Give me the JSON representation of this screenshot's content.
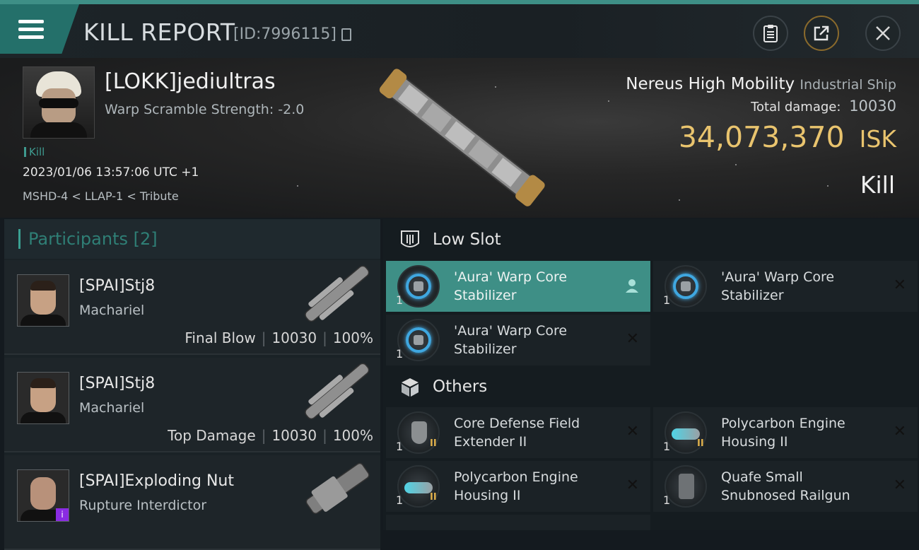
{
  "header": {
    "title": "KILL REPORT",
    "report_id": "[ID:7996115]",
    "clipboard_icon": "clipboard-icon",
    "share_icon": "share-icon",
    "close_icon": "close-icon"
  },
  "victim": {
    "name": "[LOKK]jediultras",
    "warp_scramble": "Warp Scramble Strength: -2.0",
    "kill_tag": "Kill",
    "datetime": "2023/01/06 13:57:06 UTC +1",
    "location": "MSHD-4 < LLAP-1 < Tribute",
    "ship_name": "Nereus High Mobility",
    "ship_class": "Industrial Ship",
    "total_damage_label": "Total damage:",
    "total_damage": "10030",
    "isk_value": "34,073,370",
    "isk_unit": "ISK",
    "result": "Kill"
  },
  "participants": {
    "title": "Participants",
    "count": "[2]",
    "rows": [
      {
        "name": "[SPAI]Stj8",
        "ship": "Machariel",
        "role": "Final Blow",
        "damage": "10030",
        "percent": "100%"
      },
      {
        "name": "[SPAI]Stj8",
        "ship": "Machariel",
        "role": "Top Damage",
        "damage": "10030",
        "percent": "100%"
      },
      {
        "name": "[SPAI]Exploding Nut",
        "ship": "Rupture Interdictor",
        "badge": "i"
      }
    ]
  },
  "fitting": {
    "low_slot": {
      "title": "Low Slot",
      "modules": [
        {
          "qty": "1",
          "name": "'Aura' Warp Core Stabilizer",
          "status": "person-icon"
        },
        {
          "qty": "1",
          "name": "'Aura' Warp Core Stabilizer",
          "status": "close-icon"
        },
        {
          "qty": "1",
          "name": "'Aura' Warp Core Stabilizer",
          "status": "close-icon"
        }
      ]
    },
    "others": {
      "title": "Others",
      "modules": [
        {
          "qty": "1",
          "tier": "II",
          "name": "Core Defense Field Extender II",
          "status": "close-icon"
        },
        {
          "qty": "1",
          "tier": "II",
          "name": "Polycarbon Engine Housing II",
          "status": "close-icon"
        },
        {
          "qty": "1",
          "tier": "II",
          "name": "Polycarbon Engine Housing II",
          "status": "close-icon"
        },
        {
          "qty": "1",
          "name": "Quafe Small Snubnosed Railgun",
          "status": "close-icon"
        }
      ]
    }
  }
}
